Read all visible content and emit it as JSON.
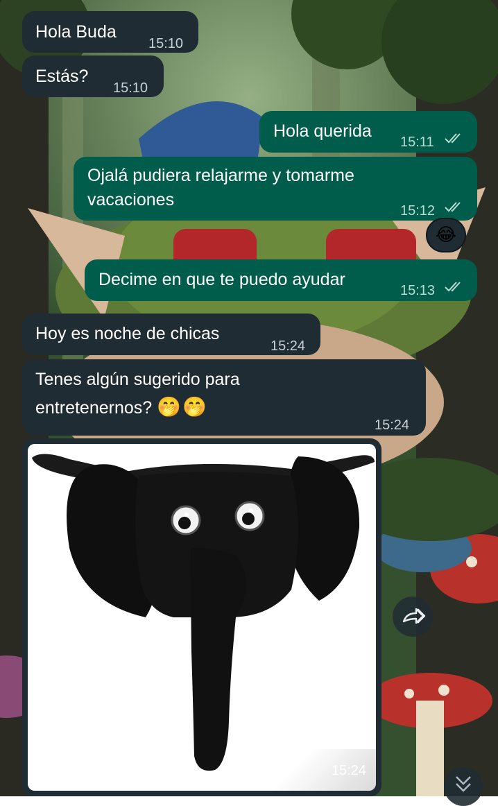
{
  "messages": [
    {
      "direction": "in",
      "text": "Hola Buda",
      "time": "15:10"
    },
    {
      "direction": "in",
      "text": "Estás?",
      "time": "15:10"
    },
    {
      "direction": "out",
      "text": "Hola querida",
      "time": "15:11",
      "status": "read"
    },
    {
      "direction": "out",
      "text_line1": "Ojalá pudiera relajarme y tomarme",
      "text_line2": "vacaciones",
      "time": "15:12",
      "status": "read",
      "reaction": "😂"
    },
    {
      "direction": "out",
      "text": "Decime en que te puedo ayudar",
      "time": "15:13",
      "status": "read"
    },
    {
      "direction": "in",
      "text": "Hoy es noche de chicas",
      "time": "15:24"
    },
    {
      "direction": "in",
      "text_line1": "Tenes algún sugerido para",
      "text_line2": "entretenernos?",
      "emojis": "🤭🤭",
      "time": "15:24"
    },
    {
      "direction": "in",
      "type": "image",
      "image_subject": "elephant-thong-photo",
      "time": "15:24"
    }
  ],
  "icons": {
    "forward": "forward-icon",
    "scroll_down": "double-chevron-down-icon",
    "read_receipt": "double-check-icon"
  },
  "colors": {
    "incoming_bubble": "#202c33",
    "outgoing_bubble": "#005c4b",
    "read_tick": "#b9dcd3"
  }
}
